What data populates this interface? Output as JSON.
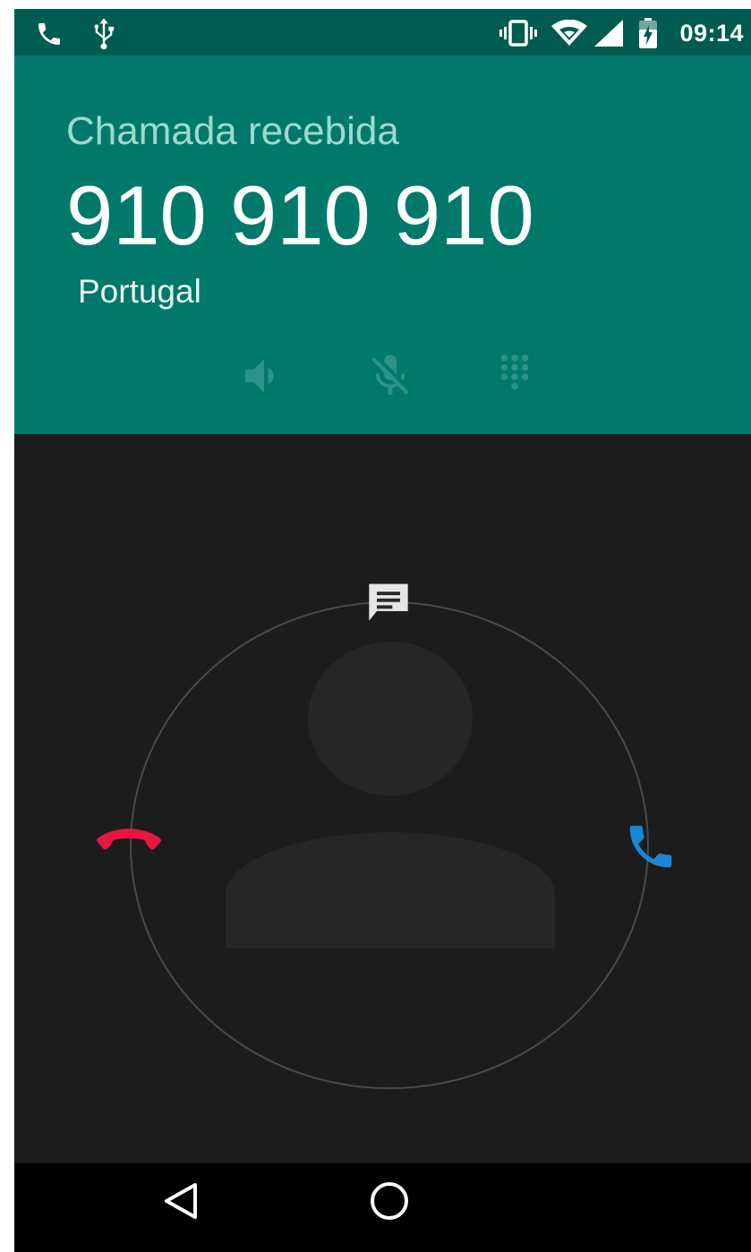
{
  "status_bar": {
    "time": "09:14",
    "left_icons": [
      "phone-icon",
      "usb-icon"
    ],
    "right_icons": [
      "vibrate-icon",
      "wifi-icon",
      "signal-icon",
      "battery-icon"
    ]
  },
  "call": {
    "state": "Chamada recebida",
    "number": "910 910 910",
    "location": "Portugal"
  },
  "call_controls": [
    "speaker-icon",
    "mute-icon",
    "dialpad-icon"
  ],
  "glowpad": {
    "targets": [
      "decline-call-icon",
      "message-icon",
      "answer-call-icon"
    ]
  },
  "colors": {
    "header": "#00796b",
    "status_bar": "#005c50",
    "background": "#1c1c1c",
    "decline": "#e8163d",
    "answer": "#1a86d6"
  },
  "navigation": [
    "back-icon",
    "home-icon"
  ]
}
